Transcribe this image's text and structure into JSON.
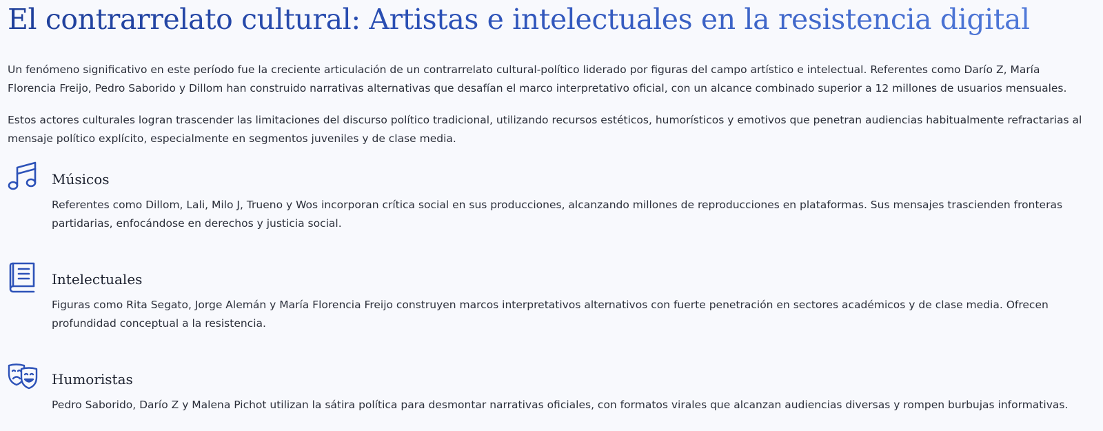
{
  "article": {
    "title": "El contrarrelato cultural: Artistas e intelectuales en la resistencia digital",
    "paragraphs": [
      "Un fenómeno significativo en este período fue la creciente articulación de un contrarrelato cultural-político liderado por figuras del campo artístico e intelectual. Referentes como Darío Z, María Florencia Freijo, Pedro Saborido y Dillom han construido narrativas alternativas que desafían el marco interpretativo oficial, con un alcance combinado superior a 12 millones de usuarios mensuales.",
      "Estos actores culturales logran trascender las limitaciones del discurso político tradicional, utilizando recursos estéticos, humorísticos y emotivos que penetran audiencias habitualmente refractarias al mensaje político explícito, especialmente en segmentos juveniles y de clase media."
    ]
  },
  "features": [
    {
      "icon": "music-notes-icon",
      "title": "Músicos",
      "text": "Referentes como Dillom, Lali, Milo J, Trueno y Wos incorporan crítica social en sus producciones, alcanzando millones de reproducciones en plataformas. Sus mensajes trascienden fronteras partidarias, enfocándose en derechos y justicia social."
    },
    {
      "icon": "book-icon",
      "title": "Intelectuales",
      "text": "Figuras como Rita Segato, Jorge Alemán y María Florencia Freijo construyen marcos interpretativos alternativos con fuerte penetración en sectores académicos y de clase media. Ofrecen profundidad conceptual a la resistencia."
    },
    {
      "icon": "theater-masks-icon",
      "title": "Humoristas",
      "text": "Pedro Saborido, Darío Z y Malena Pichot utilizan la sátira política para desmontar narrativas oficiales, con formatos virales que alcanzan audiencias diversas y rompen burbujas informativas."
    }
  ],
  "colors": {
    "accent": "#2d52b8",
    "text": "#2b2f3a",
    "background": "#f8f9fd"
  }
}
